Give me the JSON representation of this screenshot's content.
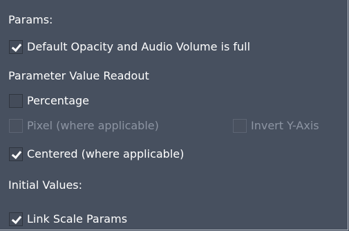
{
  "params": {
    "heading": "Params:",
    "default_opacity": {
      "label": "Default Opacity and Audio Volume is full",
      "checked": true
    }
  },
  "readout": {
    "heading": "Parameter Value Readout",
    "percentage": {
      "label": "Percentage",
      "checked": false
    },
    "pixel": {
      "label": "Pixel (where applicable)",
      "checked": false,
      "enabled": false
    },
    "invert_y": {
      "label": "Invert Y-Axis",
      "checked": false,
      "enabled": false
    },
    "centered": {
      "label": "Centered (where applicable)",
      "checked": true
    }
  },
  "initial": {
    "heading": "Initial Values:",
    "link_scale": {
      "label": "Link Scale Params",
      "checked": true
    }
  },
  "colors": {
    "background": "#47505f",
    "text": "#ffffff",
    "disabled_text": "#8d95a3"
  }
}
